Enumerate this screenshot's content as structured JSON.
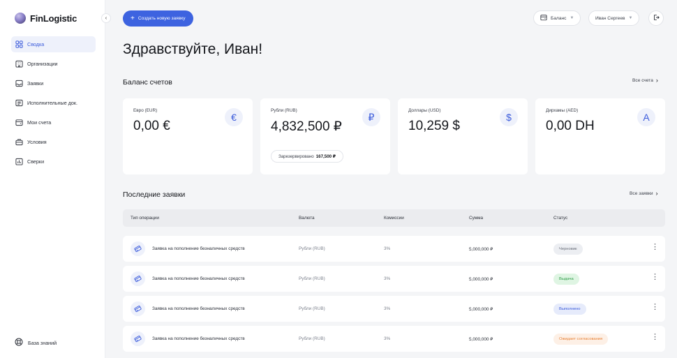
{
  "brand": {
    "name": "FinLogistic"
  },
  "sidebar": {
    "items": [
      {
        "label": "Сводка",
        "icon": "grid-icon",
        "active": true
      },
      {
        "label": "Организации",
        "icon": "building-icon",
        "active": false
      },
      {
        "label": "Заявки",
        "icon": "inbox-icon",
        "active": false
      },
      {
        "label": "Исполнительные док.",
        "icon": "document-icon",
        "active": false
      },
      {
        "label": "Мои счета",
        "icon": "wallet-icon",
        "active": false
      },
      {
        "label": "Условия",
        "icon": "briefcase-icon",
        "active": false
      },
      {
        "label": "Сверки",
        "icon": "chart-icon",
        "active": false
      }
    ],
    "footer_label": "База знаний"
  },
  "header": {
    "create_label": "Создать новую заявку",
    "balance_label": "Баланс",
    "user_label": "Иван Сергеев"
  },
  "greeting": "Здравствуйте, Иван!",
  "balances": {
    "title": "Баланс счетов",
    "see_all": "Все счета",
    "cards": [
      {
        "label": "Евро (EUR)",
        "amount": "0,00 €",
        "symbol": "€"
      },
      {
        "label": "Рубли (RUB)",
        "amount": "4,832,500 ₽",
        "symbol": "₽",
        "reserved_label": "Зарезервировано",
        "reserved_value": "167,500 ₽"
      },
      {
        "label": "Доллары (USD)",
        "amount": "10,259 $",
        "symbol": "$"
      },
      {
        "label": "Дирхамы (AED)",
        "amount": "0,00 DH",
        "symbol": "A"
      }
    ]
  },
  "orders": {
    "title": "Последние заявки",
    "see_all": "Все заявки",
    "columns": [
      "Тип операции",
      "Валюта",
      "Комиссии",
      "Сумма",
      "Статус"
    ],
    "rows": [
      {
        "type": "Заявка на пополнение безналичных средств",
        "currency": "Рубли (RUB)",
        "fee": "3%",
        "amount": "5,000,000 ₽",
        "status": "Черновик"
      },
      {
        "type": "Заявка на пополнение безналичных средств",
        "currency": "Рубли (RUB)",
        "fee": "3%",
        "amount": "5,000,000 ₽",
        "status": "Выдача"
      },
      {
        "type": "Заявка на пополнение безналичных средств",
        "currency": "Рубли (RUB)",
        "fee": "3%",
        "amount": "5,000,000 ₽",
        "status": "Выполнено"
      },
      {
        "type": "Заявка на пополнение безналичных средств",
        "currency": "Рубли (RUB)",
        "fee": "3%",
        "amount": "5,000,000 ₽",
        "status": "Ожидает согласования"
      }
    ],
    "status_colors": {
      "draft": {
        "bg": "#eceef2",
        "fg": "#6b707b"
      },
      "issue": {
        "bg": "#dff5e3",
        "fg": "#2f9d48"
      },
      "done": {
        "bg": "#e6ebfb",
        "fg": "#3b5bdb"
      },
      "pending": {
        "bg": "#fdf0e6",
        "fg": "#e8843a"
      }
    }
  },
  "colors": {
    "accent": "#3d63e0",
    "background": "#f4f5f7"
  }
}
